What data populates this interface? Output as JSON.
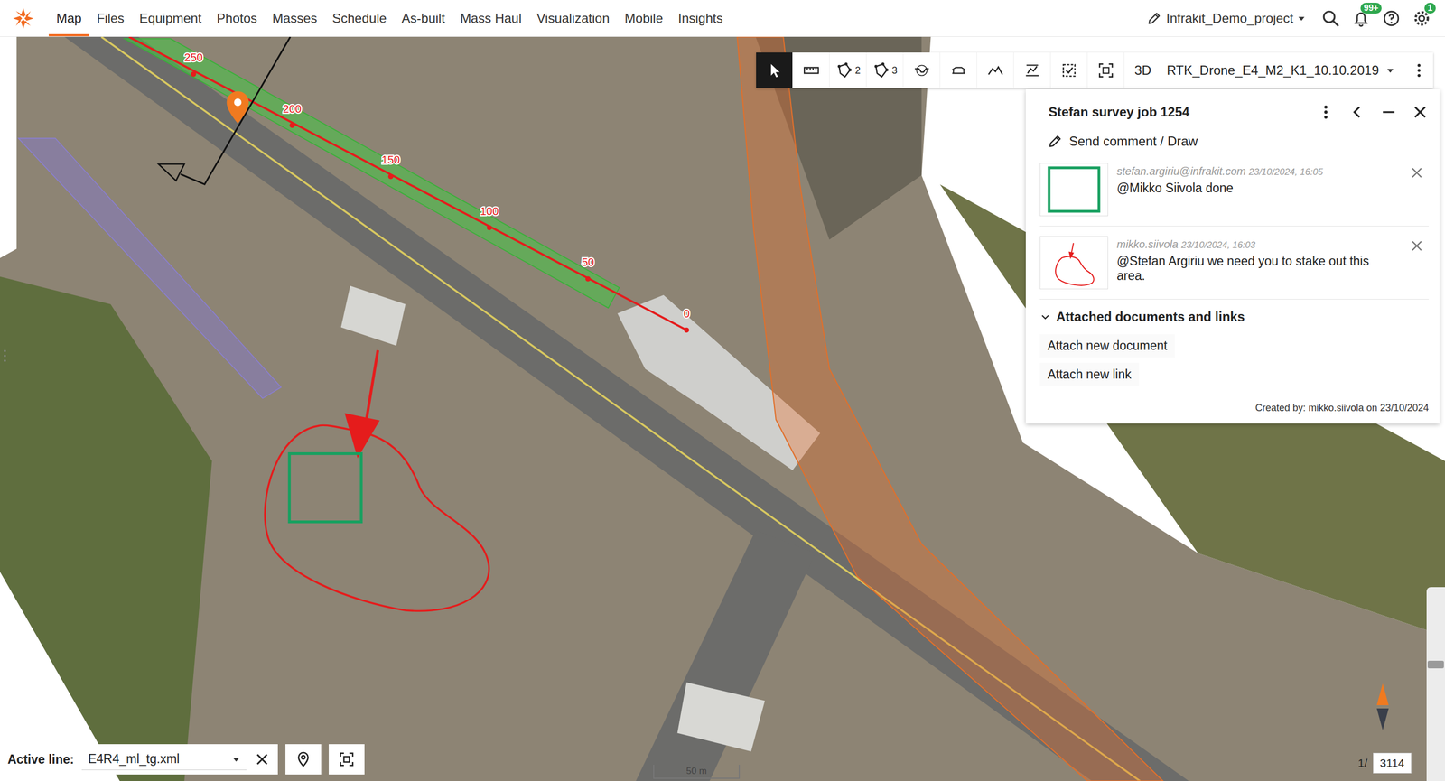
{
  "nav": {
    "tabs": [
      {
        "label": "Map",
        "selected": true
      },
      {
        "label": "Files",
        "selected": false
      },
      {
        "label": "Equipment",
        "selected": false
      },
      {
        "label": "Photos",
        "selected": false
      },
      {
        "label": "Masses",
        "selected": false
      },
      {
        "label": "Schedule",
        "selected": false
      },
      {
        "label": "As-built",
        "selected": false
      },
      {
        "label": "Mass Haul",
        "selected": false
      },
      {
        "label": "Visualization",
        "selected": false
      },
      {
        "label": "Mobile",
        "selected": false
      },
      {
        "label": "Insights",
        "selected": false
      }
    ],
    "project": "Infrakit_Demo_project",
    "notifications_badge": "99+",
    "settings_badge": "1"
  },
  "toolbar": {
    "tools": [
      {
        "kind": "pointer",
        "selected": true,
        "count": ""
      },
      {
        "kind": "ruler",
        "selected": false,
        "count": ""
      },
      {
        "kind": "polygon",
        "selected": false,
        "count": "2"
      },
      {
        "kind": "polygon",
        "selected": false,
        "count": "3"
      },
      {
        "kind": "cross-section",
        "selected": false,
        "count": ""
      },
      {
        "kind": "long-section",
        "selected": false,
        "count": ""
      },
      {
        "kind": "profile",
        "selected": false,
        "count": ""
      },
      {
        "kind": "volume",
        "selected": false,
        "count": ""
      },
      {
        "kind": "check",
        "selected": false,
        "count": ""
      },
      {
        "kind": "frame",
        "selected": false,
        "count": ""
      }
    ],
    "view_mode": "3D",
    "layer": "RTK_Drone_E4_M2_K1_10.10.2019"
  },
  "panel": {
    "title": "Stefan survey job 1254",
    "send_button": "Send comment / Draw",
    "comments": [
      {
        "author": "stefan.argiriu@infrakit.com",
        "time": "23/10/2024, 16:05",
        "text": "@Mikko Siivola done",
        "kind": "square"
      },
      {
        "author": "mikko.siivola",
        "time": "23/10/2024, 16:03",
        "text": "@Stefan Argiriu we need you to stake out this area.",
        "kind": "sketch"
      }
    ],
    "attachments": {
      "title": "Attached documents and links",
      "expanded": true,
      "actions": [
        "Attach new document",
        "Attach new link"
      ]
    },
    "footer": "Created by: mikko.siivola on 23/10/2024"
  },
  "map": {
    "stations": [
      "0",
      "50",
      "100",
      "150",
      "200",
      "250"
    ],
    "scale": "50 m",
    "zoom_level": 0.62
  },
  "bottom_bar": {
    "label": "Active line:",
    "line": "E4R4_ml_tg.xml"
  },
  "pager": {
    "current": "1/",
    "total": "3114"
  }
}
